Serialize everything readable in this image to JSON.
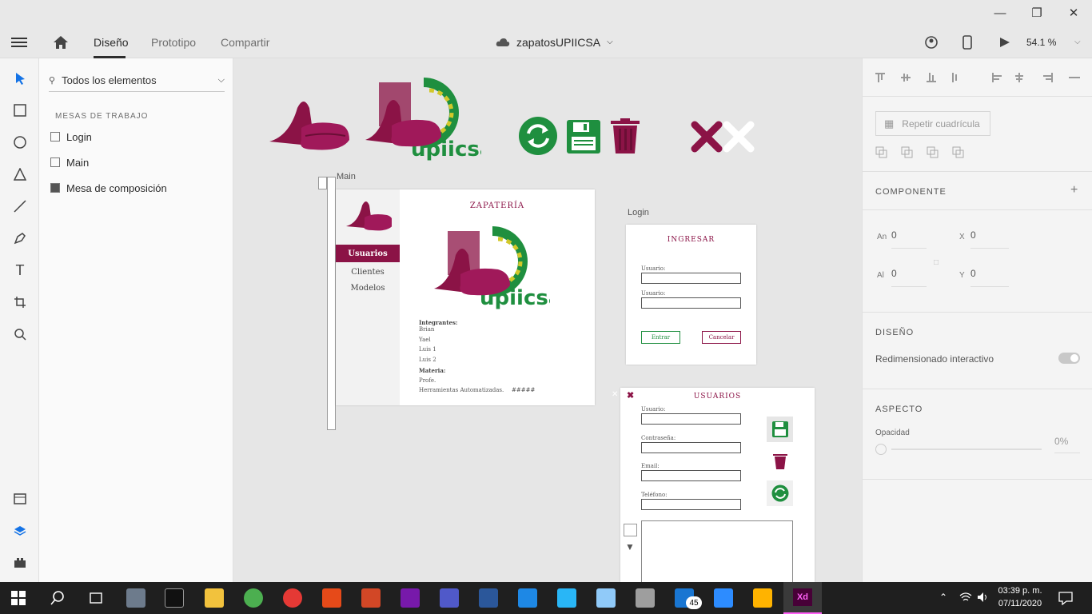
{
  "appbar": {
    "tabs": [
      "Diseño",
      "Prototipo",
      "Compartir"
    ],
    "doc_title": "zapatosUPIICSA",
    "zoom": "54.1 %"
  },
  "layers": {
    "filter_label": "Todos los elementos",
    "section": "MESAS DE TRABAJO",
    "items": [
      "Login",
      "Main",
      "Mesa de composición"
    ]
  },
  "canvas": {
    "main_label": "Main",
    "login_label": "Login",
    "main": {
      "title": "ZAPATERÍA",
      "nav": [
        "Usuarios",
        "Clientes",
        "Modelos"
      ],
      "integrantes_label": "Integrantes:",
      "integrantes": [
        "Brian",
        "Yael",
        "Luis 1",
        "Luis 2"
      ],
      "materia_label": "Materia:",
      "profe": "Profe.",
      "materia": "Herramientas Automatizadas.",
      "hash": "#####"
    },
    "login": {
      "title": "INGRESAR",
      "user_label1": "Usuario:",
      "user_label2": "Usuario:",
      "enter": "Entrar",
      "cancel": "Cancelar"
    },
    "usuarios": {
      "title": "USUARIOS",
      "fields": [
        "Usuario:",
        "Contraseña:",
        "Email:",
        "Teléfono:"
      ]
    }
  },
  "props": {
    "repeat_grid": "Repetir cuadrícula",
    "componente": "COMPONENTE",
    "an_label": "An",
    "an_value": "0",
    "x_label": "X",
    "x_value": "0",
    "al_label": "Al",
    "al_value": "0",
    "y_label": "Y",
    "y_value": "0",
    "diseno": "DISEÑO",
    "redimensionado": "Redimensionado interactivo",
    "aspecto": "ASPECTO",
    "opacidad": "Opacidad",
    "opacidad_value": "0%"
  },
  "taskbar": {
    "time": "03:39 p. m.",
    "date": "07/11/2020",
    "mail_badge": "45"
  },
  "colors": {
    "maroon": "#8b1346",
    "green": "#1f8f3f",
    "accent": "#1473e6"
  }
}
